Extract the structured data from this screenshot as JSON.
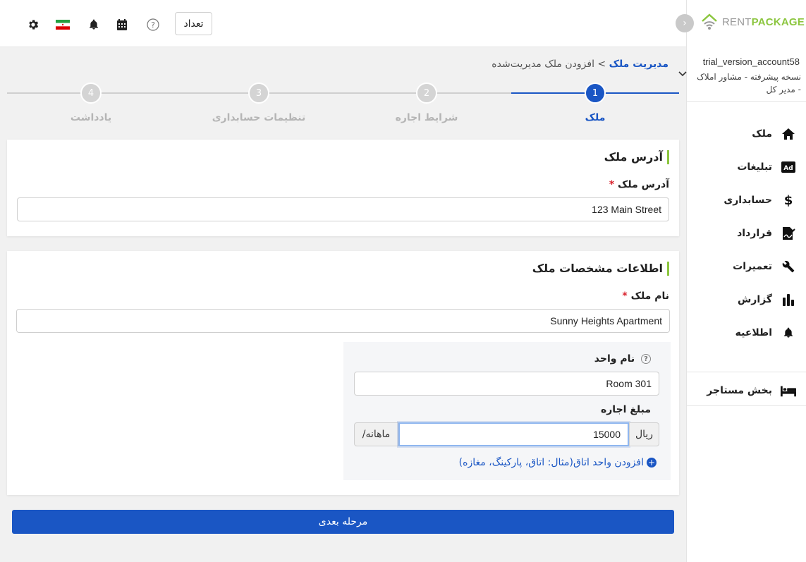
{
  "brand": {
    "logo_part1": "RENT",
    "logo_part2": "PACKAGE"
  },
  "header": {
    "count_button": "تعداد"
  },
  "account": {
    "username": "trial_version_account58",
    "role": "نسخه پیشرفته - مشاور املاک - مدیر کل"
  },
  "sidebar": {
    "items": [
      {
        "label": "ملک",
        "icon": "home-icon"
      },
      {
        "label": "تبلیغات",
        "icon": "ad-icon"
      },
      {
        "label": "حسابداری",
        "icon": "dollar-icon"
      },
      {
        "label": "قرارداد",
        "icon": "contract-icon"
      },
      {
        "label": "تعمیرات",
        "icon": "wrench-icon"
      },
      {
        "label": "گزارش",
        "icon": "bar-chart-icon"
      },
      {
        "label": "اطلاعیه",
        "icon": "bell-icon"
      }
    ],
    "tenant_section": {
      "label": "بخش مستاجر",
      "icon": "bed-icon"
    }
  },
  "breadcrumb": {
    "parent": "مدیریت ملک",
    "separator": ">",
    "current": "افزودن ملک مدیریت‌شده"
  },
  "stepper": {
    "steps": [
      {
        "number": "1",
        "label": "ملک",
        "active": true
      },
      {
        "number": "2",
        "label": "شرایط اجاره",
        "active": false
      },
      {
        "number": "3",
        "label": "تنظیمات حسابداری",
        "active": false
      },
      {
        "number": "4",
        "label": "یادداشت",
        "active": false
      }
    ]
  },
  "address_card": {
    "title": "آدرس ملک",
    "field_label": "آدرس ملک",
    "required_mark": "*",
    "value": "123 Main Street"
  },
  "specs_card": {
    "title": "اطلاعات مشخصات ملک",
    "name_label": "نام ملک",
    "required_mark": "*",
    "name_value": "Sunny Heights Apartment",
    "unit": {
      "unit_name_label": "نام واحد",
      "unit_name_value": "Room 301",
      "rent_label": "مبلغ اجاره",
      "rent_currency": "ریال",
      "rent_value": "15000",
      "rent_period": "/ماهانه",
      "add_unit_label": "افزودن واحد اتاق(مثال: اتاق، پارکینگ، مغازه)"
    }
  },
  "next_button": "مرحله بعدی",
  "colors": {
    "primary": "#1a56c4",
    "brand_green": "#8cc63f",
    "required": "#d9232e"
  }
}
